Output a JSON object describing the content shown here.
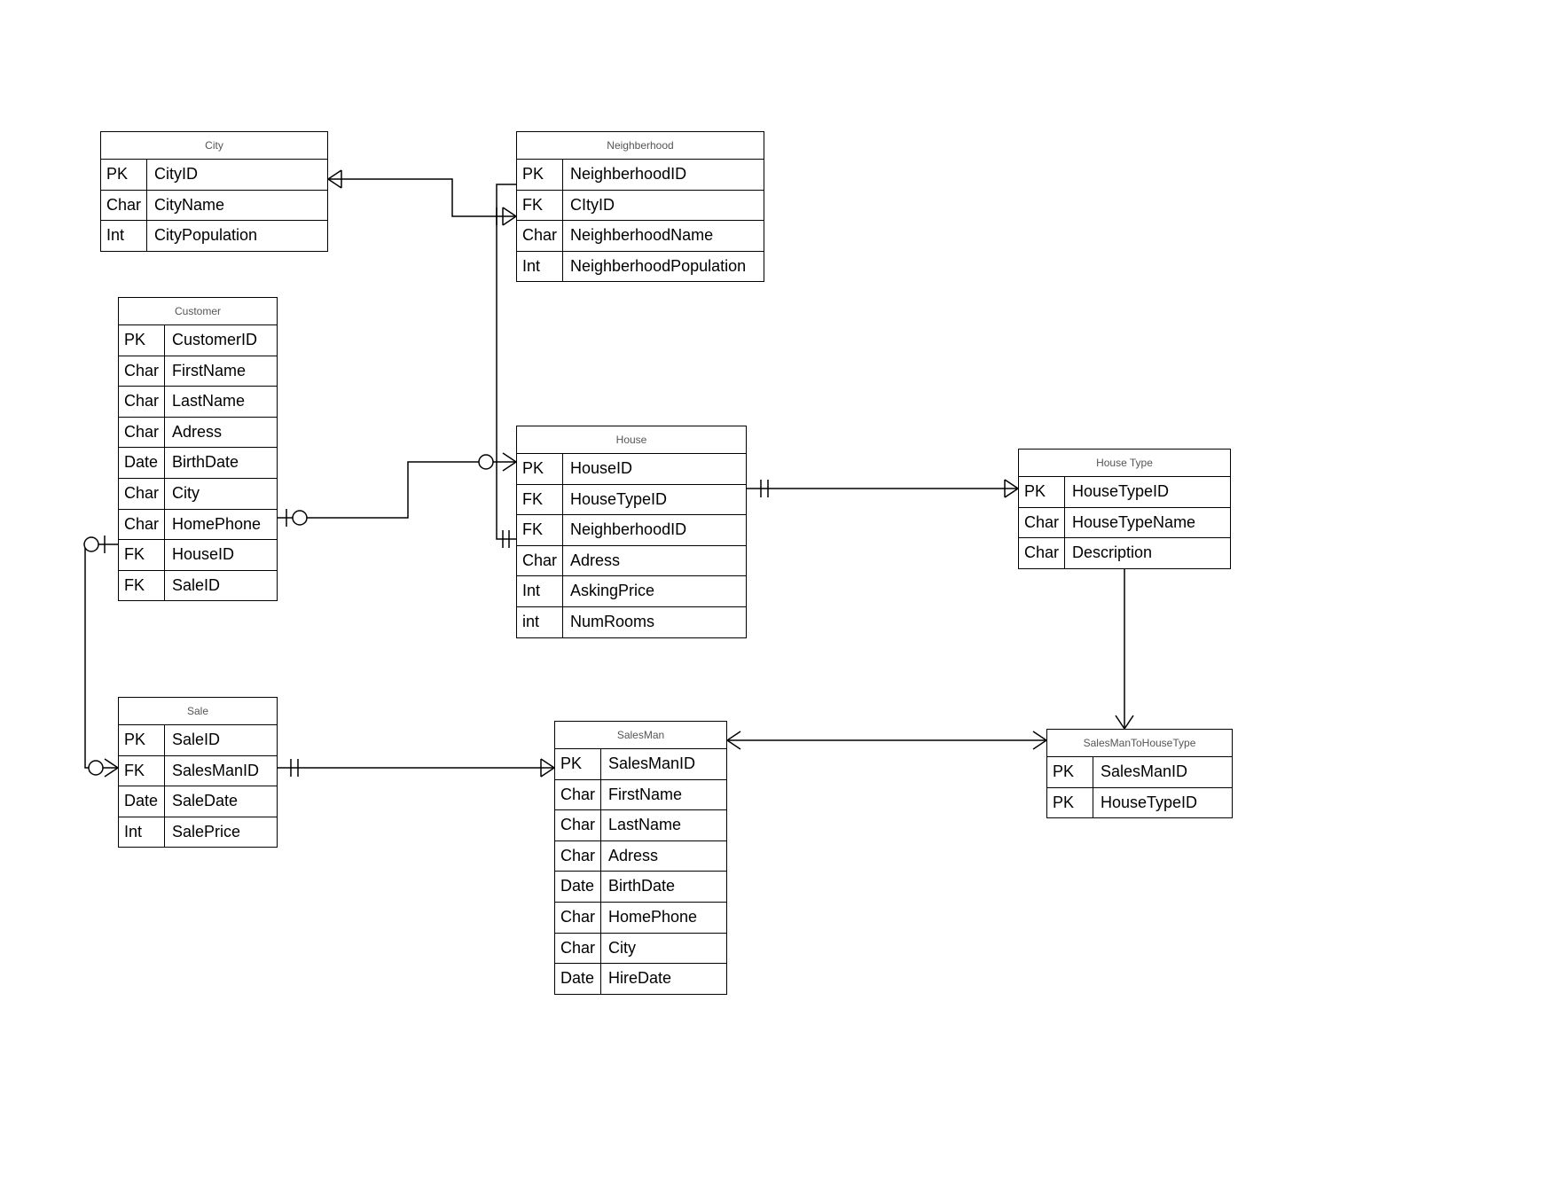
{
  "entities": {
    "city": {
      "title": "City",
      "rows": [
        {
          "t": "PK",
          "n": "CityID"
        },
        {
          "t": "Char",
          "n": "CityName"
        },
        {
          "t": "Int",
          "n": "CityPopulation"
        }
      ]
    },
    "neighberhood": {
      "title": "Neighberhood",
      "rows": [
        {
          "t": "PK",
          "n": "NeighberhoodID"
        },
        {
          "t": "FK",
          "n": "CItyID"
        },
        {
          "t": "Char",
          "n": "NeighberhoodName"
        },
        {
          "t": "Int",
          "n": "NeighberhoodPopulation"
        }
      ]
    },
    "customer": {
      "title": "Customer",
      "rows": [
        {
          "t": "PK",
          "n": "CustomerID"
        },
        {
          "t": "Char",
          "n": "FirstName"
        },
        {
          "t": "Char",
          "n": "LastName"
        },
        {
          "t": "Char",
          "n": "Adress"
        },
        {
          "t": "Date",
          "n": "BirthDate"
        },
        {
          "t": "Char",
          "n": "City"
        },
        {
          "t": "Char",
          "n": "HomePhone"
        },
        {
          "t": "FK",
          "n": "HouseID"
        },
        {
          "t": "FK",
          "n": "SaleID"
        }
      ]
    },
    "house": {
      "title": "House",
      "rows": [
        {
          "t": "PK",
          "n": "HouseID"
        },
        {
          "t": "FK",
          "n": "HouseTypeID"
        },
        {
          "t": "FK",
          "n": "NeighberhoodID"
        },
        {
          "t": "Char",
          "n": "Adress"
        },
        {
          "t": "Int",
          "n": "AskingPrice"
        },
        {
          "t": "int",
          "n": "NumRooms"
        }
      ]
    },
    "housetype": {
      "title": "House Type",
      "rows": [
        {
          "t": "PK",
          "n": "HouseTypeID"
        },
        {
          "t": "Char",
          "n": "HouseTypeName"
        },
        {
          "t": "Char",
          "n": "Description"
        }
      ]
    },
    "sale": {
      "title": "Sale",
      "rows": [
        {
          "t": "PK",
          "n": "SaleID"
        },
        {
          "t": "FK",
          "n": "SalesManID"
        },
        {
          "t": "Date",
          "n": "SaleDate"
        },
        {
          "t": "Int",
          "n": "SalePrice"
        }
      ]
    },
    "salesman": {
      "title": "SalesMan",
      "rows": [
        {
          "t": "PK",
          "n": "SalesManID"
        },
        {
          "t": "Char",
          "n": "FirstName"
        },
        {
          "t": "Char",
          "n": "LastName"
        },
        {
          "t": "Char",
          "n": "Adress"
        },
        {
          "t": "Date",
          "n": "BirthDate"
        },
        {
          "t": "Char",
          "n": "HomePhone"
        },
        {
          "t": "Char",
          "n": "City"
        },
        {
          "t": "Date",
          "n": "HireDate"
        }
      ]
    },
    "salesmantohousetype": {
      "title": "SalesManToHouseType",
      "rows": [
        {
          "t": "PK",
          "n": "SalesManID"
        },
        {
          "t": "PK",
          "n": "HouseTypeID"
        }
      ]
    }
  },
  "relationships": [
    {
      "from": "City",
      "to": "Neighberhood",
      "cardinality": "one-to-many"
    },
    {
      "from": "Neighberhood",
      "to": "House",
      "cardinality": "one-to-many"
    },
    {
      "from": "House",
      "to": "Customer",
      "cardinality": "one-to-zero-or-many"
    },
    {
      "from": "House Type",
      "to": "House",
      "cardinality": "one-to-many"
    },
    {
      "from": "House Type",
      "to": "SalesManToHouseType",
      "cardinality": "one-to-many"
    },
    {
      "from": "SalesMan",
      "to": "SalesManToHouseType",
      "cardinality": "one-to-many"
    },
    {
      "from": "SalesMan",
      "to": "Sale",
      "cardinality": "one-to-many"
    },
    {
      "from": "Sale",
      "to": "Customer",
      "cardinality": "one-to-zero-or-many"
    },
    {
      "from": "Customer",
      "to": "Customer",
      "cardinality": "self-zero-or-one"
    }
  ]
}
